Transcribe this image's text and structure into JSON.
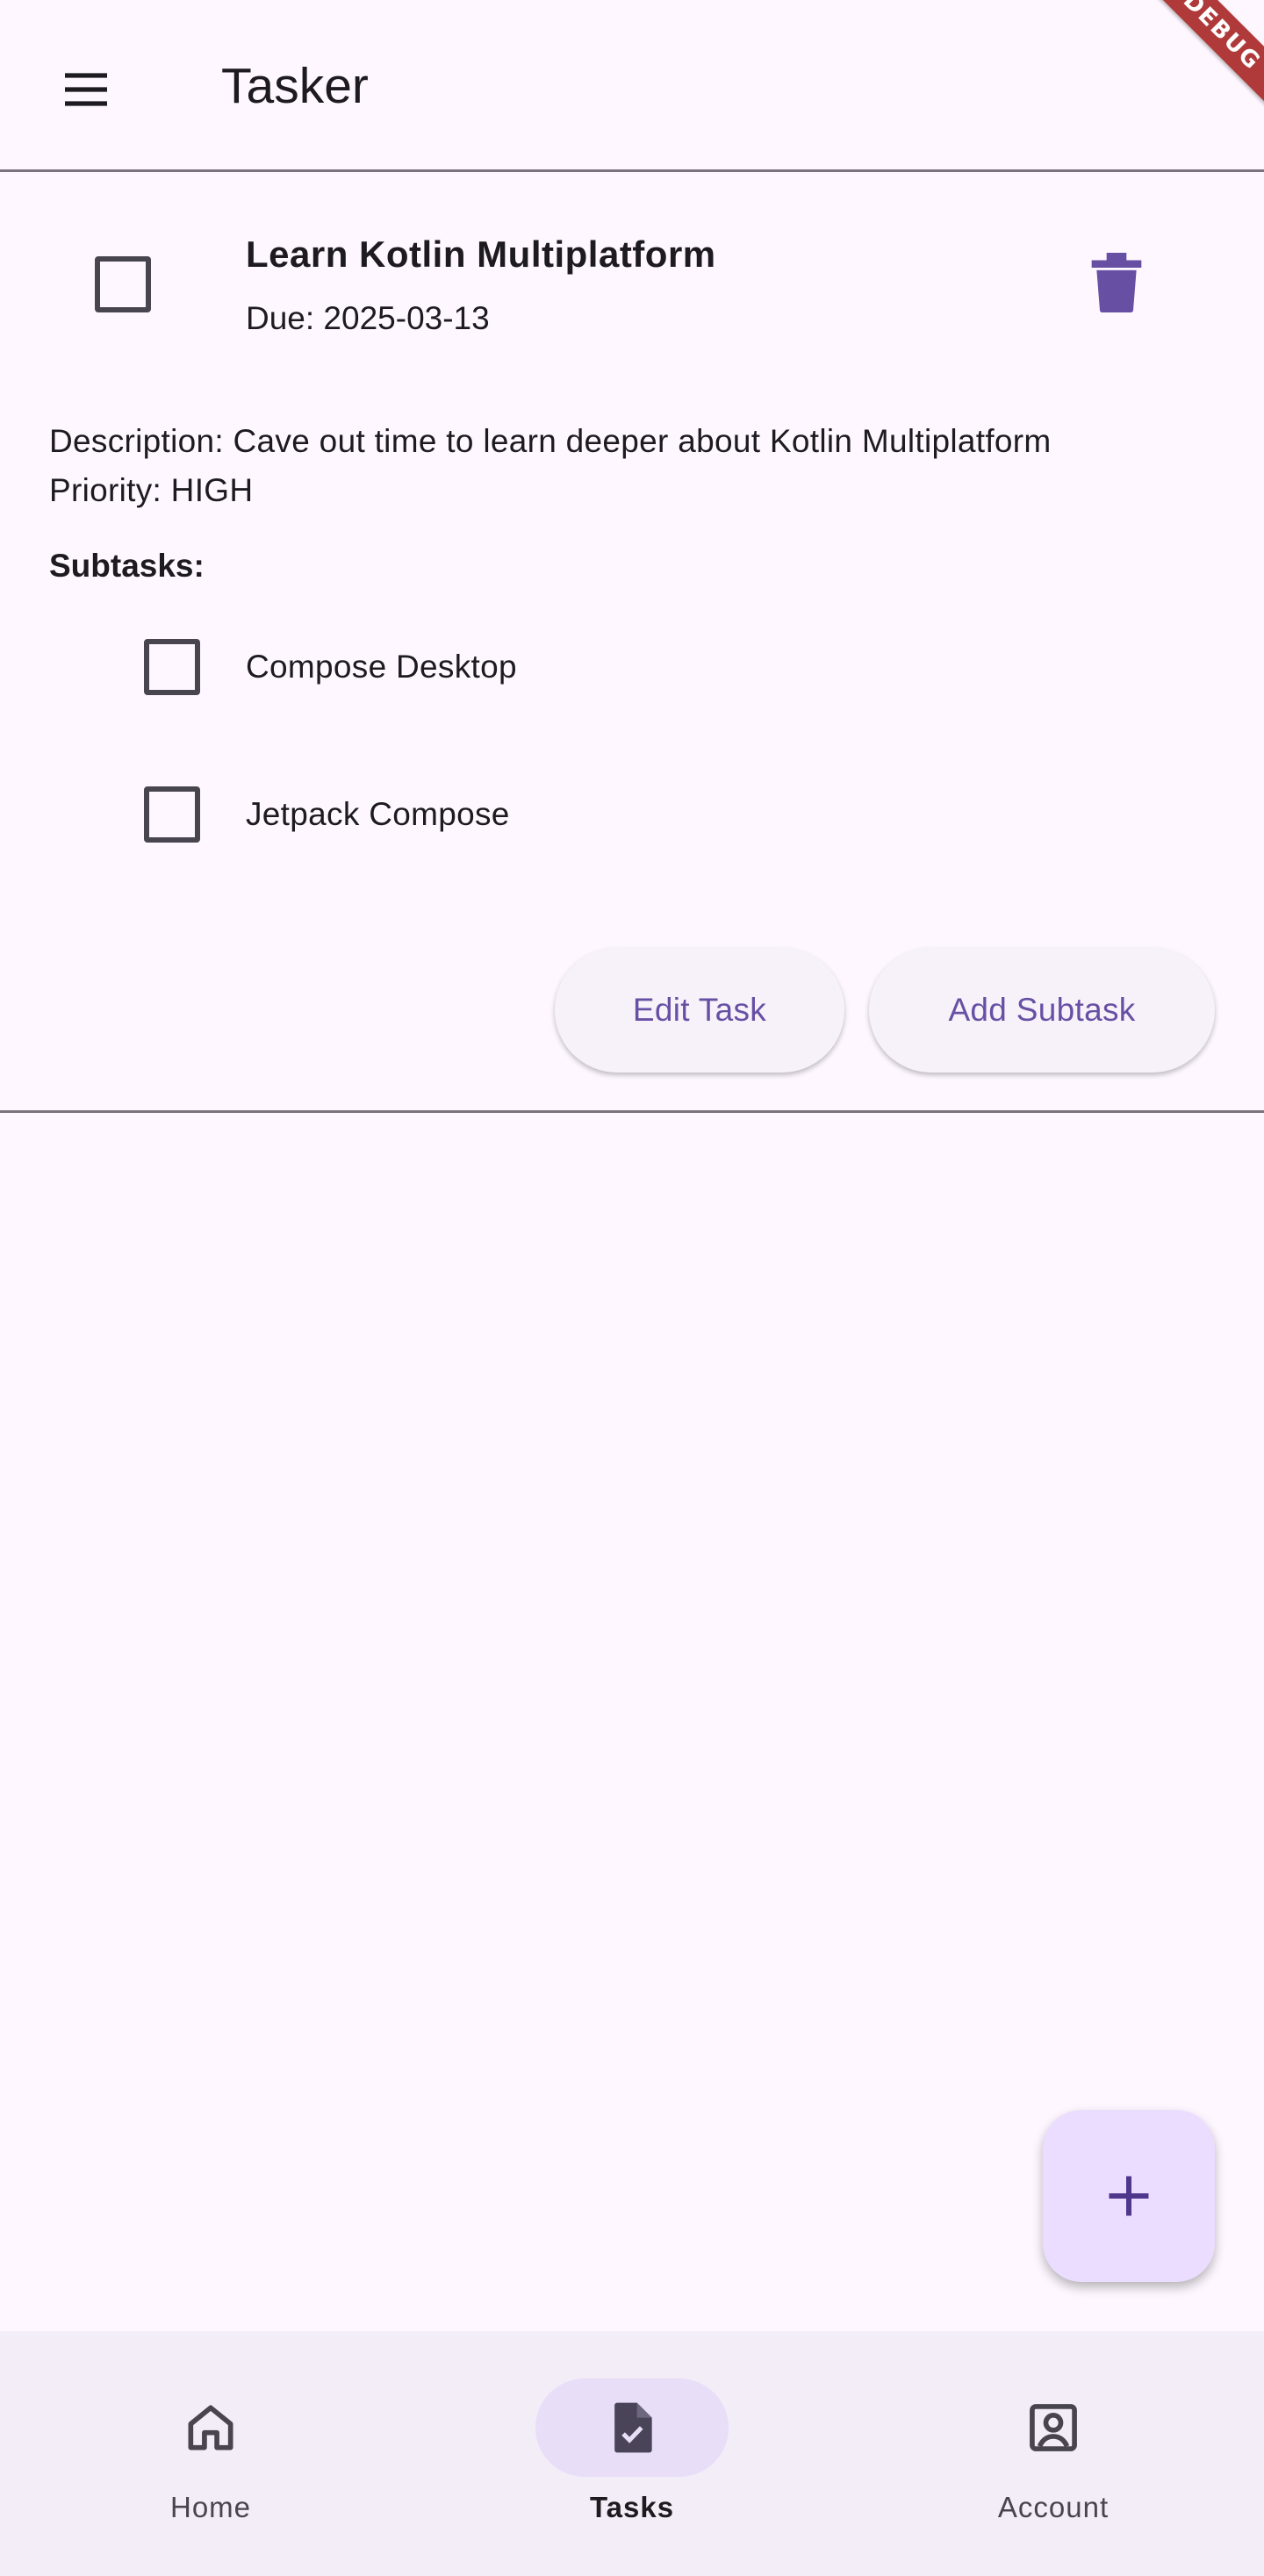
{
  "app": {
    "title": "Tasker",
    "debug_banner": "DEBUG"
  },
  "icons": {
    "menu": "menu-icon",
    "delete": "trash-icon",
    "add": "plus-icon",
    "home": "home-icon",
    "tasks": "task-file-icon",
    "account": "account-box-icon"
  },
  "colors": {
    "background": "#fef7ff",
    "primary": "#6750a4",
    "fab_background": "#eaddff",
    "nav_background": "#f3edf7",
    "nav_indicator": "#e8def8",
    "outline": "#79747e",
    "debug_banner": "#b03a3a"
  },
  "task": {
    "title": "Learn Kotlin Multiplatform",
    "due": "Due: 2025-03-13",
    "completed": false,
    "description": "Description: Cave out time to learn deeper about Kotlin Multiplatform",
    "priority": "Priority: HIGH",
    "subtasks_heading": "Subtasks:",
    "subtasks": [
      {
        "label": "Compose Desktop",
        "completed": false
      },
      {
        "label": "Jetpack Compose",
        "completed": false
      }
    ],
    "edit_label": "Edit Task",
    "add_subtask_label": "Add Subtask"
  },
  "bottom_nav": {
    "selected": "Tasks",
    "items": [
      {
        "label": "Home"
      },
      {
        "label": "Tasks"
      },
      {
        "label": "Account"
      }
    ]
  }
}
